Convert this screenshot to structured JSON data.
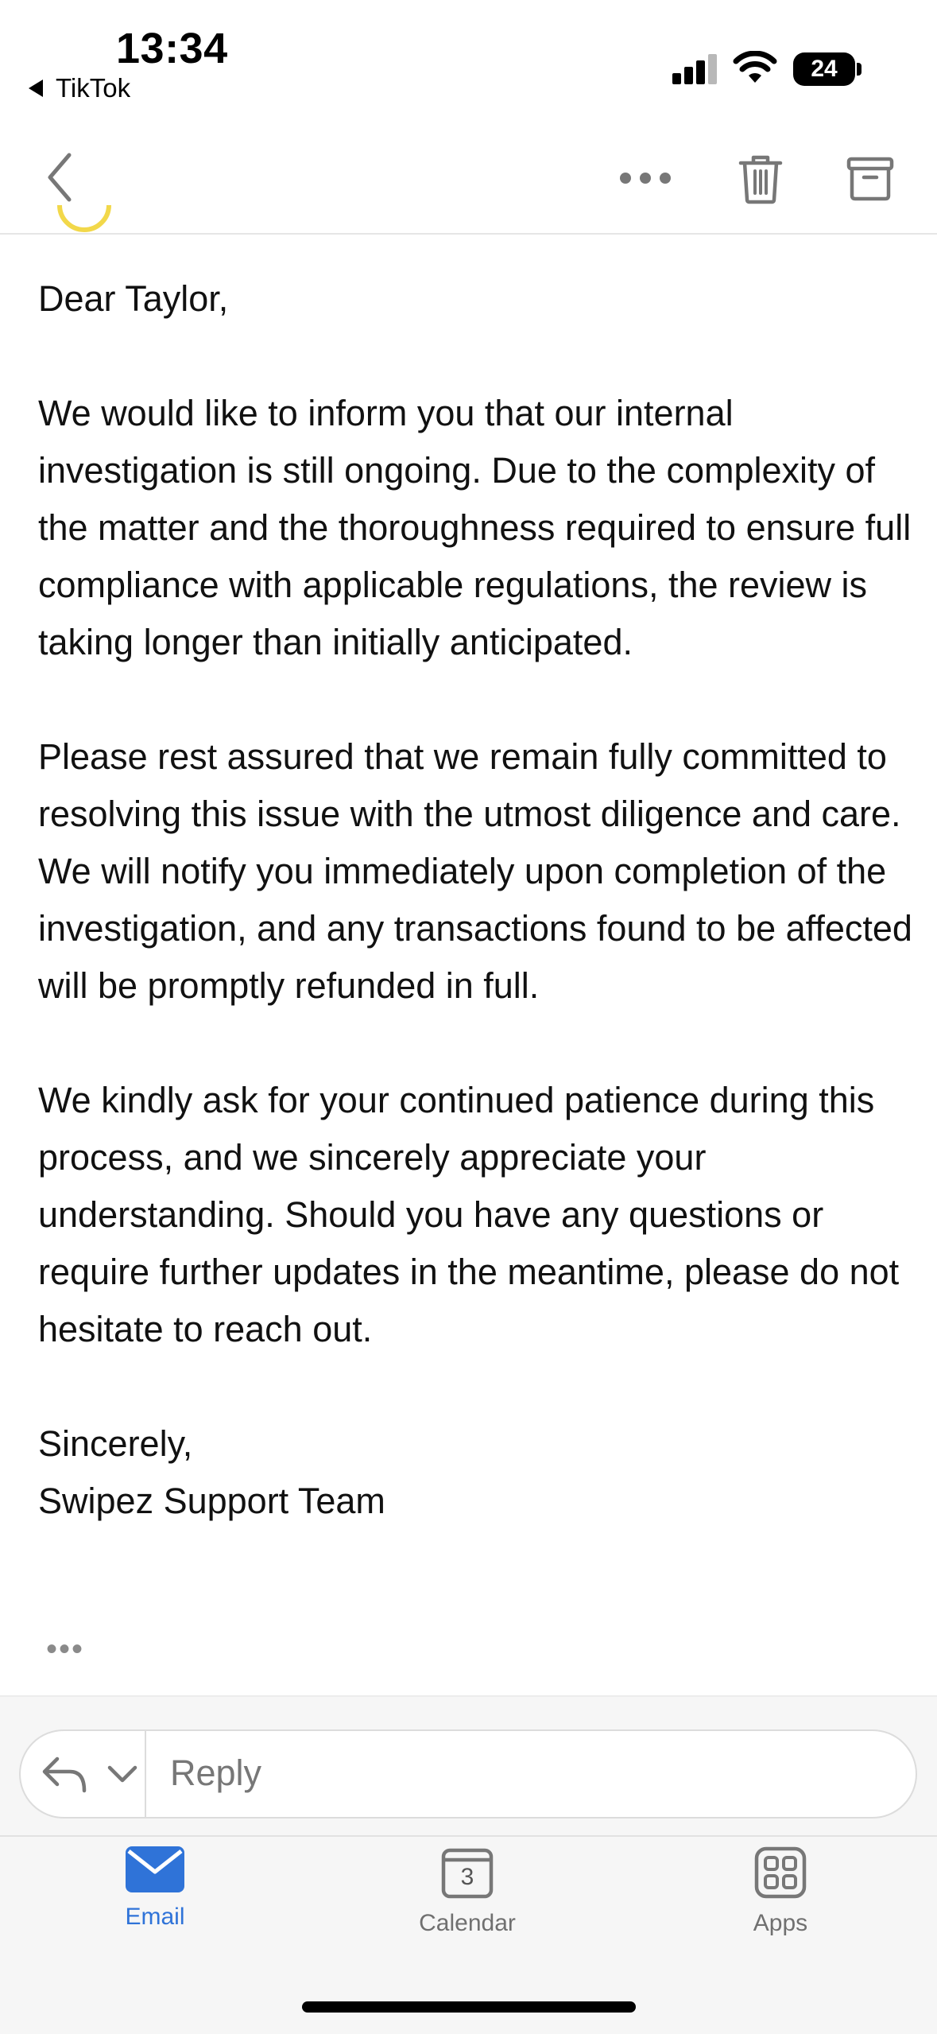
{
  "status_bar": {
    "time": "13:34",
    "back_app": "TikTok",
    "battery": "24",
    "icons": [
      "signal-icon",
      "wifi-icon",
      "battery-icon"
    ]
  },
  "toolbar": {
    "icons": [
      "chevron-left-icon",
      "more-icon",
      "trash-icon",
      "archive-icon"
    ]
  },
  "email": {
    "greeting": "Dear Taylor,",
    "paragraphs": [
      "We would like to inform you that our internal investigation is still ongoing. Due to the complexity of the matter and the thoroughness required to ensure full compliance with applicable regulations, the review is taking longer than initially anticipated.",
      "Please rest assured that we remain fully committed to resolving this issue with the utmost diligence and care. We will notify you immediately upon completion of the investigation, and any transactions found to be affected will be promptly refunded in full.",
      "We kindly ask for your continued patience during this process, and we sincerely appreciate your understanding. Should you have any questions or require further updates in the meantime, please do not hesitate to reach out."
    ],
    "closing": "Sincerely,",
    "signature": "Swipez Support Team",
    "more_indicator": "•••"
  },
  "reply": {
    "placeholder": "Reply"
  },
  "tabs": [
    {
      "label": "Email",
      "icon": "mail-icon",
      "active": true
    },
    {
      "label": "Calendar",
      "icon": "calendar-icon",
      "badge": "3",
      "active": false
    },
    {
      "label": "Apps",
      "icon": "apps-grid-icon",
      "active": false
    }
  ],
  "colors": {
    "accent": "#2f73d8",
    "background": "#ffffff",
    "bar_background": "#f6f6f6"
  }
}
